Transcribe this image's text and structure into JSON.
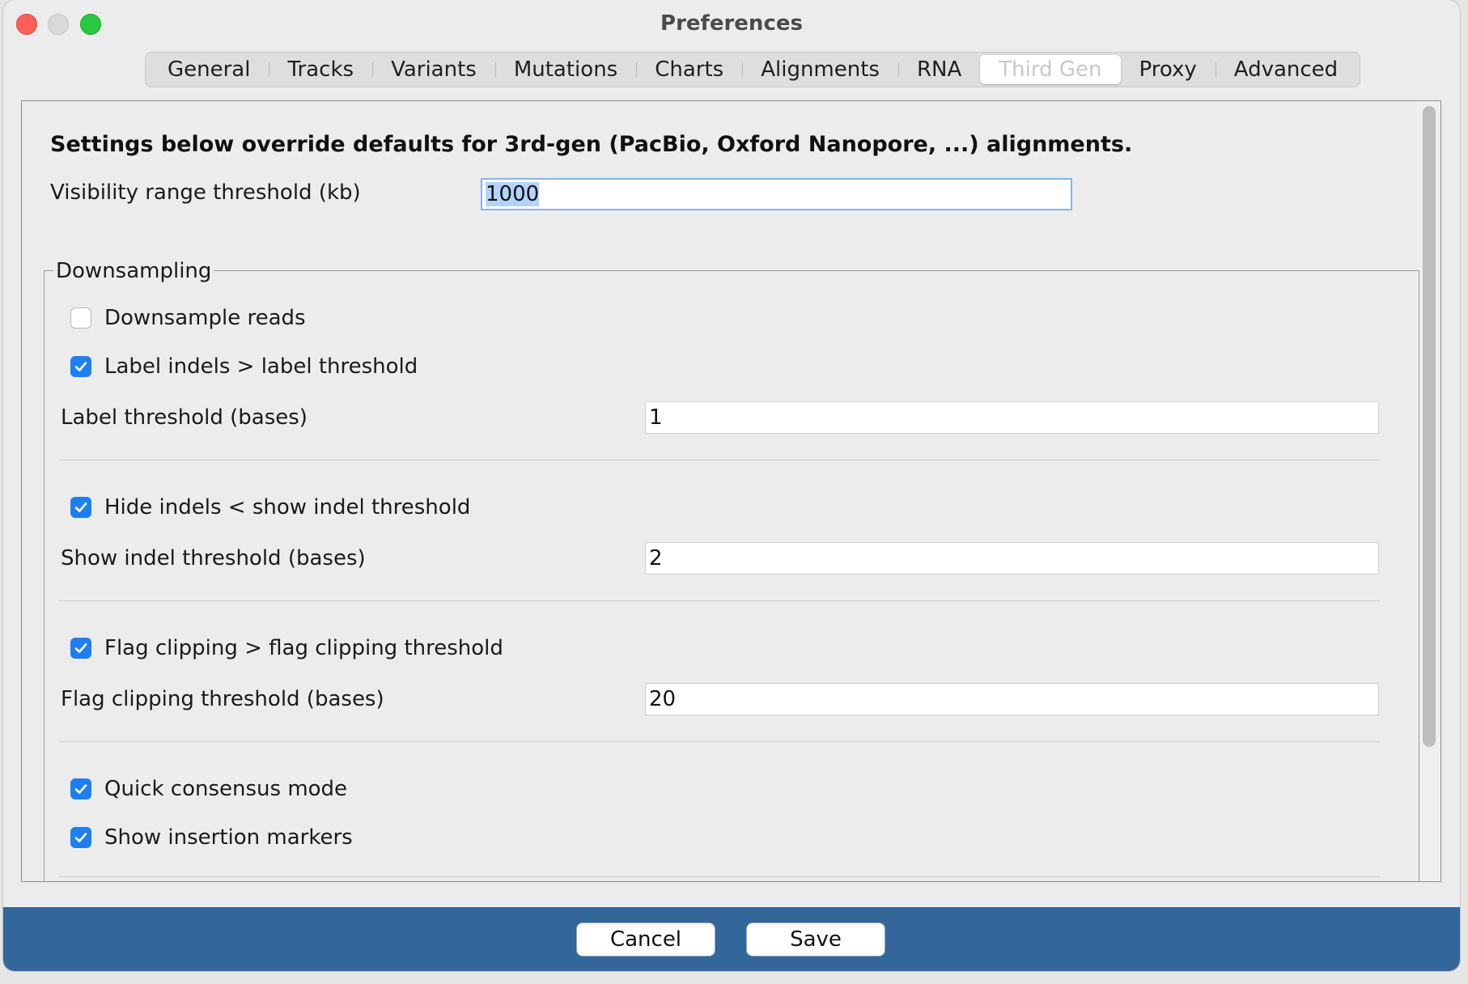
{
  "window": {
    "title": "Preferences"
  },
  "tabs": [
    {
      "label": "General"
    },
    {
      "label": "Tracks"
    },
    {
      "label": "Variants"
    },
    {
      "label": "Mutations"
    },
    {
      "label": "Charts"
    },
    {
      "label": "Alignments"
    },
    {
      "label": "RNA"
    },
    {
      "label": "Third Gen",
      "selected": true
    },
    {
      "label": "Proxy"
    },
    {
      "label": "Advanced"
    }
  ],
  "panel": {
    "heading": "Settings below override defaults for 3rd-gen (PacBio, Oxford Nanopore, ...) alignments.",
    "visibility_label": "Visibility range threshold (kb)",
    "visibility_value": "1000"
  },
  "downsampling": {
    "title": "Downsampling",
    "downsample_reads": {
      "label": "Downsample reads",
      "checked": false
    },
    "label_indels": {
      "label": "Label indels > label threshold",
      "checked": true
    },
    "label_threshold": {
      "label": "Label threshold (bases)",
      "value": "1"
    },
    "hide_indels": {
      "label": "Hide indels < show indel threshold",
      "checked": true
    },
    "show_indel_threshold": {
      "label": "Show indel threshold (bases)",
      "value": "2"
    },
    "flag_clipping": {
      "label": "Flag clipping > flag clipping threshold",
      "checked": true
    },
    "flag_clipping_threshold": {
      "label": "Flag clipping threshold (bases)",
      "value": "20"
    },
    "quick_consensus": {
      "label": "Quick consensus mode",
      "checked": true
    },
    "show_insertion_markers": {
      "label": "Show insertion markers",
      "checked": true
    }
  },
  "footer": {
    "cancel_label": "Cancel",
    "save_label": "Save"
  },
  "colors": {
    "accent": "#1d7ff2",
    "footer": "#336699",
    "focus": "#86b3ea"
  }
}
